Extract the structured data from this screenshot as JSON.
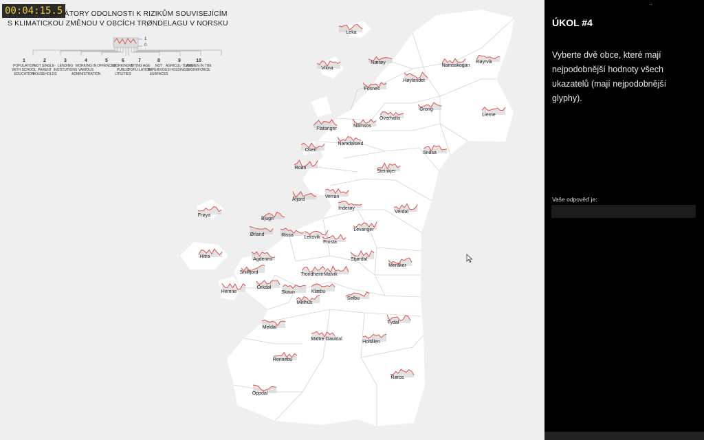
{
  "timer": "00:04:15.5",
  "title": {
    "line1": "VYBRANÉ INDIKÁTORY ODOLNOSTI K RIZIKŮM SOUVISEJÍCÍM",
    "line2": "S KLIMATICKOU ZMĚNOU V OBCÍCH TRØNDELAGU V NORSKU"
  },
  "legend": {
    "scale_max": "1",
    "scale_min": "0",
    "indicators": [
      {
        "num": "1",
        "label": "POPULATION WITH SCHOOL EDUCATION"
      },
      {
        "num": "2",
        "label": "NOT SINGLE-PARENT HOUSEHOLDS"
      },
      {
        "num": "3",
        "label": "LENDING INSTITUTIONS"
      },
      {
        "num": "4",
        "label": "WORKING IN VARIOUS ADMINISTRATION"
      },
      {
        "num": "5",
        "label": "OFFENCES"
      },
      {
        "num": "6",
        "label": "WORKING IN PUBLIC UTILITIES"
      },
      {
        "num": "7",
        "label": "VOTING AGE POPU-LATION"
      },
      {
        "num": "8",
        "label": "NOT IMPERVIOUS SURFACES"
      },
      {
        "num": "9",
        "label": "AGRICUL-TURAL HOLDINGS"
      },
      {
        "num": "10",
        "label": "WOMEN IN THE WORKFORCE"
      }
    ]
  },
  "municipalities": [
    {
      "name": "Leka"
    },
    {
      "name": "Vikna"
    },
    {
      "name": "Nærøy"
    },
    {
      "name": "Namsskogan"
    },
    {
      "name": "Røyrvik"
    },
    {
      "name": "Høylandet"
    },
    {
      "name": "Fosnes"
    },
    {
      "name": "Grong"
    },
    {
      "name": "Lierne"
    },
    {
      "name": "Overhalla"
    },
    {
      "name": "Flatanger"
    },
    {
      "name": "Namsos"
    },
    {
      "name": "Namdalseid"
    },
    {
      "name": "Osen"
    },
    {
      "name": "Snåsa"
    },
    {
      "name": "Roan"
    },
    {
      "name": "Steinkjer"
    },
    {
      "name": "Åfjord"
    },
    {
      "name": "Verran"
    },
    {
      "name": "Inderøy"
    },
    {
      "name": "Verdal"
    },
    {
      "name": "Frøya"
    },
    {
      "name": "Bjugn"
    },
    {
      "name": "Ørland"
    },
    {
      "name": "Rissa"
    },
    {
      "name": "Leksvik"
    },
    {
      "name": "Frosta"
    },
    {
      "name": "Levanger"
    },
    {
      "name": "Hitra"
    },
    {
      "name": "Agdenes"
    },
    {
      "name": "Stjørdal"
    },
    {
      "name": "Meråker"
    },
    {
      "name": "Snillfjord"
    },
    {
      "name": "Trondheim"
    },
    {
      "name": "Malvik"
    },
    {
      "name": "Hemne"
    },
    {
      "name": "Orkdal"
    },
    {
      "name": "Skaun"
    },
    {
      "name": "Klæbu"
    },
    {
      "name": "Melhus"
    },
    {
      "name": "Selbu"
    },
    {
      "name": "Tydal"
    },
    {
      "name": "Meldal"
    },
    {
      "name": "Midtre Gauldal"
    },
    {
      "name": "Holtålen"
    },
    {
      "name": "Rennebu"
    },
    {
      "name": "Røros"
    },
    {
      "name": "Oppdal"
    }
  ],
  "panel": {
    "title": "ÚKOL #4",
    "text": "Vyberte dvě obce, které mají nejpodobnější hodnoty všech ukazatelů (mají nejpodobnější glyphy).",
    "answer_label": "Vaše odpověď je:",
    "answer_value": ""
  },
  "colors": {
    "glyph_line": "#e05050",
    "glyph_fill": "#cfcfcf",
    "map_land": "#ffffff",
    "map_water": "#efefef",
    "panel_bg": "#000000",
    "timer_text": "#f2d22a"
  }
}
